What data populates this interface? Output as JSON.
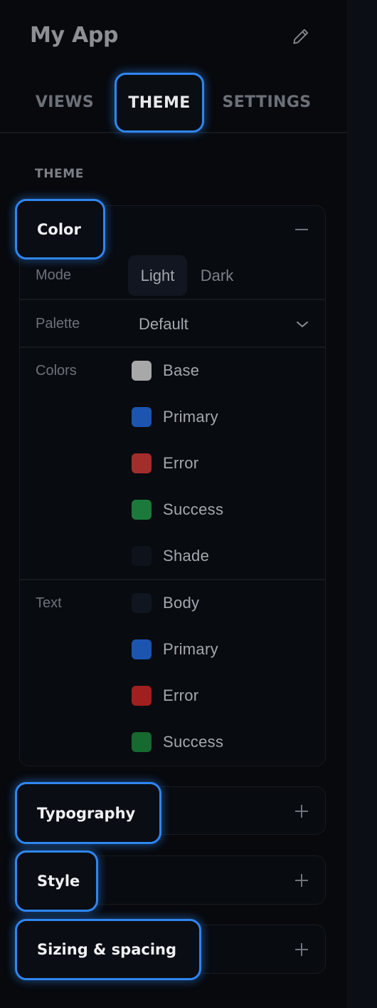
{
  "app": {
    "title": "My App",
    "edit_icon": "pencil-icon"
  },
  "tabs": [
    {
      "label": "VIEWS",
      "active": false
    },
    {
      "label": "THEME",
      "active": true
    },
    {
      "label": "SETTINGS",
      "active": false
    }
  ],
  "section_label": "THEME",
  "color_section": {
    "title": "Color",
    "expanded": true,
    "toggle_icon": "minus-icon",
    "mode": {
      "label": "Mode",
      "options": [
        "Light",
        "Dark"
      ],
      "selected": "Light"
    },
    "palette": {
      "label": "Palette",
      "value": "Default",
      "icon": "chevron-down-icon"
    },
    "colors": {
      "label": "Colors",
      "items": [
        {
          "name": "Base",
          "color": "#a8a8a8"
        },
        {
          "name": "Primary",
          "color": "#1c55b0"
        },
        {
          "name": "Error",
          "color": "#a32d2b"
        },
        {
          "name": "Success",
          "color": "#1b7a3b"
        },
        {
          "name": "Shade",
          "color": "#0e131b"
        }
      ]
    },
    "text": {
      "label": "Text",
      "items": [
        {
          "name": "Body",
          "color": "#0f1620"
        },
        {
          "name": "Primary",
          "color": "#1c55b0"
        },
        {
          "name": "Error",
          "color": "#a21f1f"
        },
        {
          "name": "Success",
          "color": "#16692f"
        }
      ]
    }
  },
  "collapsed_sections": [
    {
      "title": "Typography",
      "toggle_icon": "plus-icon"
    },
    {
      "title": "Style",
      "toggle_icon": "plus-icon"
    },
    {
      "title": "Sizing & spacing",
      "toggle_icon": "plus-icon"
    }
  ],
  "accent_color": "#2f86f0"
}
